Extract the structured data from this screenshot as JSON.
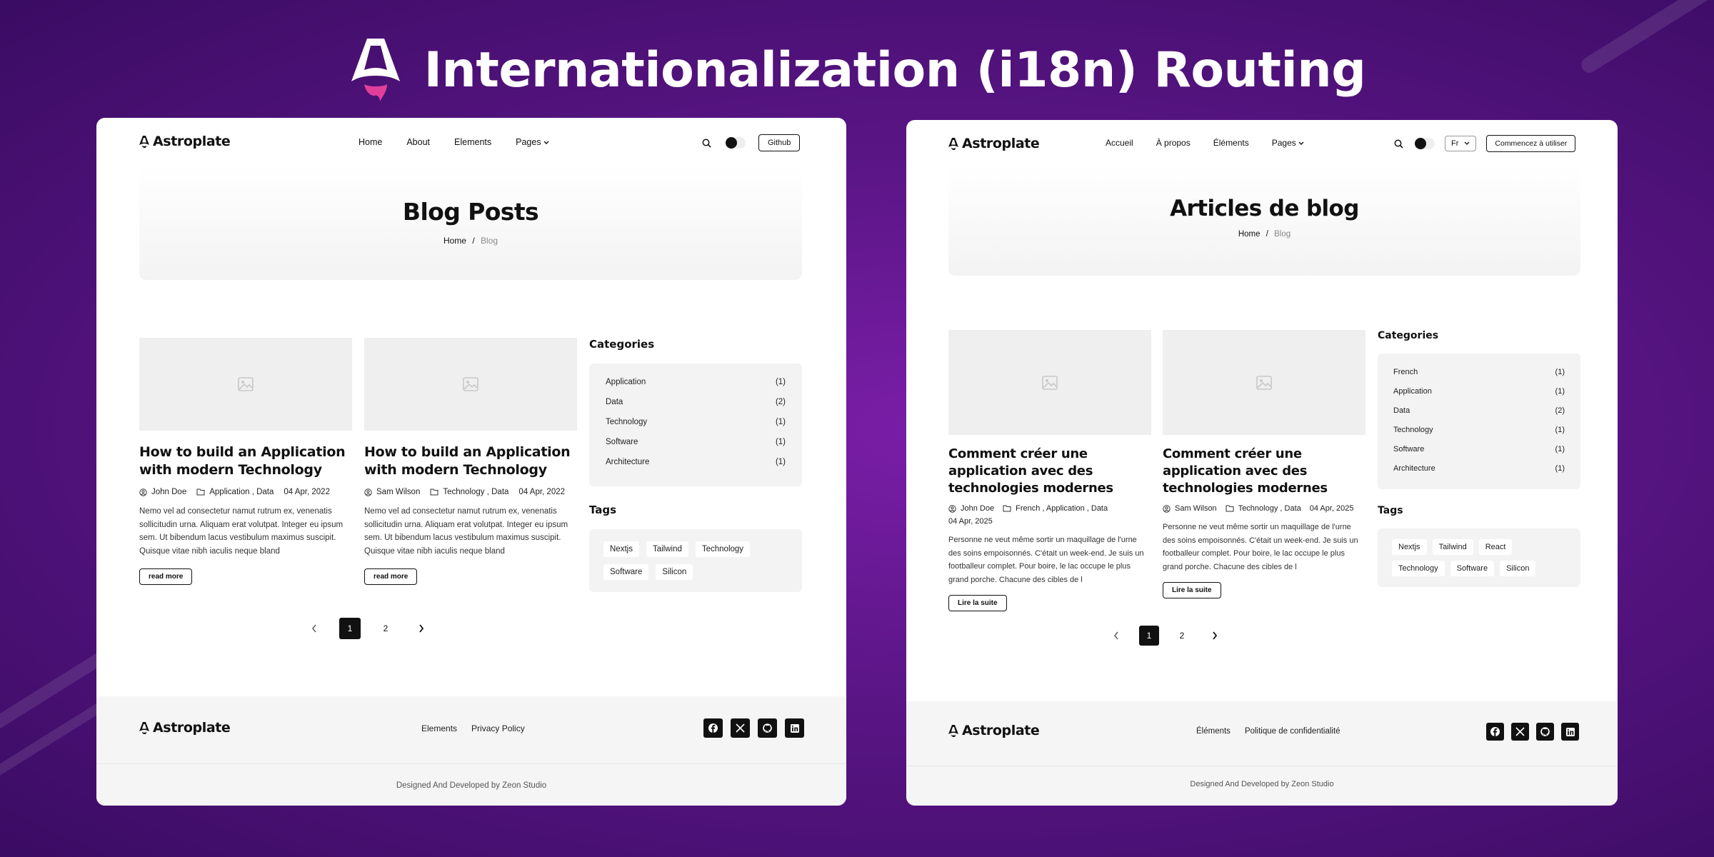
{
  "banner": {
    "title": "Internationalization (i18n) Routing"
  },
  "left": {
    "brand": "Astroplate",
    "nav": [
      "Home",
      "About",
      "Elements",
      "Pages"
    ],
    "github_label": "Github",
    "page_title": "Blog Posts",
    "breadcrumb": {
      "home": "Home",
      "sep": "/",
      "current": "Blog"
    },
    "posts": [
      {
        "title": "How to build an Application with modern Technology",
        "author": "John Doe",
        "categories": "Application , Data",
        "date": "04 Apr, 2022",
        "excerpt": "Nemo vel ad consectetur namut rutrum ex, venenatis sollicitudin urna. Aliquam erat volutpat. Integer eu ipsum sem. Ut bibendum lacus vestibulum maximus suscipit. Quisque vitae nibh iaculis neque bland",
        "button": "read more"
      },
      {
        "title": "How to build an Application with modern Technology",
        "author": "Sam Wilson",
        "categories": "Technology , Data",
        "date": "04 Apr, 2022",
        "excerpt": "Nemo vel ad consectetur namut rutrum ex, venenatis sollicitudin urna. Aliquam erat volutpat. Integer eu ipsum sem. Ut bibendum lacus vestibulum maximus suscipit. Quisque vitae nibh iaculis neque bland",
        "button": "read more"
      }
    ],
    "categories_title": "Categories",
    "categories": [
      {
        "name": "Application",
        "count": "(1)"
      },
      {
        "name": "Data",
        "count": "(2)"
      },
      {
        "name": "Technology",
        "count": "(1)"
      },
      {
        "name": "Software",
        "count": "(1)"
      },
      {
        "name": "Architecture",
        "count": "(1)"
      }
    ],
    "tags_title": "Tags",
    "tags": [
      "Nextjs",
      "Tailwind",
      "Technology",
      "Software",
      "Silicon"
    ],
    "pagination": {
      "pages": [
        "1",
        "2"
      ],
      "current": "1"
    },
    "footer": {
      "brand": "Astroplate",
      "links": [
        "Elements",
        "Privacy Policy"
      ],
      "copyright": "Designed And Developed by Zeon Studio"
    }
  },
  "right": {
    "brand": "Astroplate",
    "nav": [
      "Accueil",
      "À propos",
      "Éléments",
      "Pages"
    ],
    "lang_value": "Fr",
    "cta_label": "Commencez à utiliser",
    "page_title": "Articles de blog",
    "breadcrumb": {
      "home": "Home",
      "sep": "/",
      "current": "Blog"
    },
    "posts": [
      {
        "title": "Comment créer une application avec des technologies modernes",
        "author": "John Doe",
        "categories": "French , Application , Data",
        "date": "04 Apr, 2025",
        "excerpt": "Personne ne veut même sortir un maquillage de l'urne des soins empoisonnés. C'était un week-end. Je suis un footballeur complet. Pour boire, le lac occupe le plus grand porche. Chacune des cibles de l",
        "button": "Lire la suite"
      },
      {
        "title": "Comment créer une application avec des technologies modernes",
        "author": "Sam Wilson",
        "categories": "Technology , Data",
        "date": "04 Apr, 2025",
        "excerpt": "Personne ne veut même sortir un maquillage de l'urne des soins empoisonnés. C'était un week-end. Je suis un footballeur complet. Pour boire, le lac occupe le plus grand porche. Chacune des cibles de l",
        "button": "Lire la suite"
      }
    ],
    "categories_title": "Categories",
    "categories": [
      {
        "name": "French",
        "count": "(1)"
      },
      {
        "name": "Application",
        "count": "(1)"
      },
      {
        "name": "Data",
        "count": "(2)"
      },
      {
        "name": "Technology",
        "count": "(1)"
      },
      {
        "name": "Software",
        "count": "(1)"
      },
      {
        "name": "Architecture",
        "count": "(1)"
      }
    ],
    "tags_title": "Tags",
    "tags": [
      "Nextjs",
      "Tailwind",
      "React",
      "Technology",
      "Software",
      "Silicon"
    ],
    "pagination": {
      "pages": [
        "1",
        "2"
      ],
      "current": "1"
    },
    "footer": {
      "brand": "Astroplate",
      "links": [
        "Éléments",
        "Politique de confidentialité"
      ],
      "copyright": "Designed And Developed by Zeon Studio"
    }
  },
  "icons": {
    "logo": "astro-logo-icon",
    "search": "search-icon",
    "theme": "theme-toggle-icon",
    "chevron": "chevron-down-icon",
    "image": "image-placeholder-icon",
    "author": "user-icon",
    "category": "folder-icon",
    "prev": "chevron-left-icon",
    "next": "chevron-right-icon",
    "socials": [
      "facebook-icon",
      "x-icon",
      "github-icon",
      "linkedin-icon"
    ]
  },
  "colors": {
    "background": "#5a1585",
    "accent": "#111111",
    "banner_accent": "#e0409b"
  }
}
